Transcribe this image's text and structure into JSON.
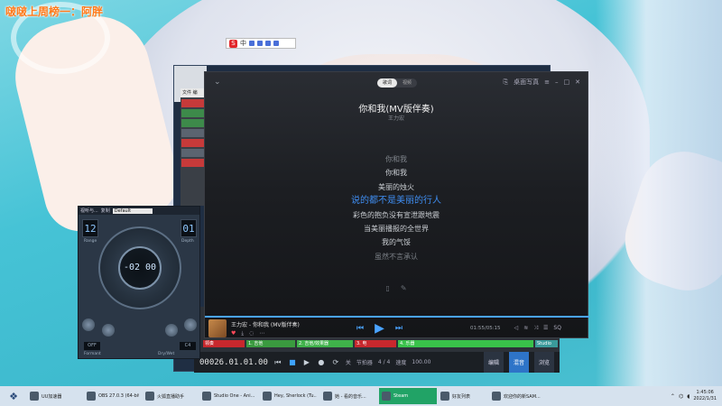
{
  "wallpaper": {
    "overlay_text": "啵啵上周榜一：阿胖"
  },
  "ime": {
    "logo": "S",
    "mode": "中"
  },
  "player": {
    "tabs": [
      "歌词",
      "视频"
    ],
    "active_tab": "歌词",
    "desktop_lyrics_label": "桌面写真",
    "song_title": "你和我(MV版伴奏)",
    "artist": "王力宏",
    "lyrics": [
      {
        "text": "你和我",
        "state": "past"
      },
      {
        "text": "你和我",
        "state": "normal"
      },
      {
        "text": "美丽的烛火",
        "state": "normal"
      },
      {
        "text": "说的都不是美丽的行人",
        "state": "current"
      },
      {
        "text": "彩色的抱负没有宣泄跟地震",
        "state": "normal"
      },
      {
        "text": "当美丽播报的全世界",
        "state": "normal"
      },
      {
        "text": "我的气馁",
        "state": "normal"
      },
      {
        "text": "虽然不言承认",
        "state": "past"
      }
    ],
    "now_playing": "王力宏 - 你和我 (MV版伴奏)",
    "time": "01:55/05:15",
    "quality": "SQ"
  },
  "daw": {
    "tracks": [
      "领奏",
      "1. 吉他",
      "2. 吉他/效果器",
      "3. 电",
      "4. 乐器",
      "Studio"
    ],
    "track_colors": [
      "#c8282d",
      "#3a9a3f",
      "#3fb24a",
      "#c8282d",
      "#39c24a",
      "#3a9a9a"
    ],
    "time": "00026.01.01.00",
    "tempo": "100.00",
    "meter": "4 / 4",
    "tabs": [
      "编辑",
      "混音",
      "浏览"
    ],
    "active_tab": "混音",
    "labels": {
      "key": "关",
      "beat": "节拍器",
      "tempo_label": "速度"
    }
  },
  "plugin": {
    "header": "视听与...",
    "menu": "复制",
    "preset": "Default",
    "left_value": "12",
    "right_value": "01",
    "center_value": "-02 00",
    "bottom_left": "OFF",
    "bottom_right": "C4",
    "labels": {
      "range": "Range",
      "depth": "Depth",
      "formant": "Formant",
      "power": "Power",
      "dry_wet": "Dry/Wet"
    }
  },
  "taskbar": {
    "items": [
      {
        "label": "UU加速器",
        "active": false
      },
      {
        "label": "OBS 27.0.3 (64-bit...",
        "active": false
      },
      {
        "label": "火狐直播助手",
        "active": false
      },
      {
        "label": "Studio One - Ani...",
        "active": false
      },
      {
        "label": "Hey, Sherlock (Tu...",
        "active": false
      },
      {
        "label": "她 - 看的音乐...",
        "active": false
      },
      {
        "label": "Steam",
        "active": true
      },
      {
        "label": "好友列表",
        "active": false
      },
      {
        "label": "欢迎你的新SAM...",
        "active": false
      }
    ],
    "time": "1:45:06",
    "date": "2022/1/31"
  }
}
